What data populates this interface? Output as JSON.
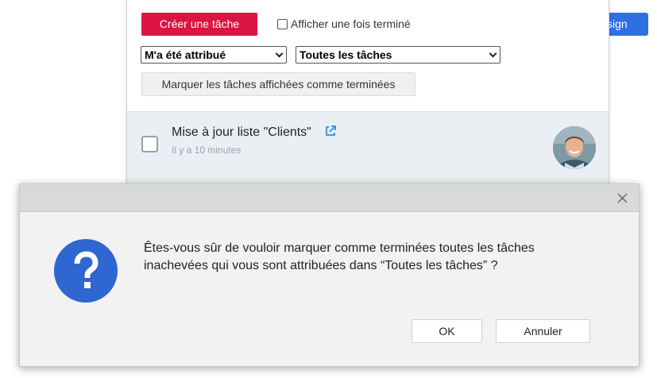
{
  "background": {
    "assign_button_label": "sign"
  },
  "toolbar": {
    "create_task_label": "Créer une tâche",
    "show_done_label": "Afficher une fois terminé",
    "assigned_filter_value": "M'a été attribué",
    "tasks_filter_value": "Toutes les tâches",
    "mark_done_label": "Marquer les tâches affichées comme terminées"
  },
  "task": {
    "title": "Mise à jour liste \"Clients\"",
    "time": "Il y a 10 minutes"
  },
  "dialog": {
    "message_line1": "Êtes-vous sûr de vouloir marquer comme terminées toutes les tâches",
    "message_line2": "inachevées qui vous sont attribuées dans “Toutes les tâches” ?",
    "ok_label": "OK",
    "cancel_label": "Annuler",
    "icon": "question-icon",
    "close_icon": "close-icon"
  },
  "colors": {
    "create_button": "#dc1441",
    "assign_button": "#2f6fe4",
    "question_icon": "#2f66d0",
    "external_link_icon": "#2f8fe0"
  }
}
